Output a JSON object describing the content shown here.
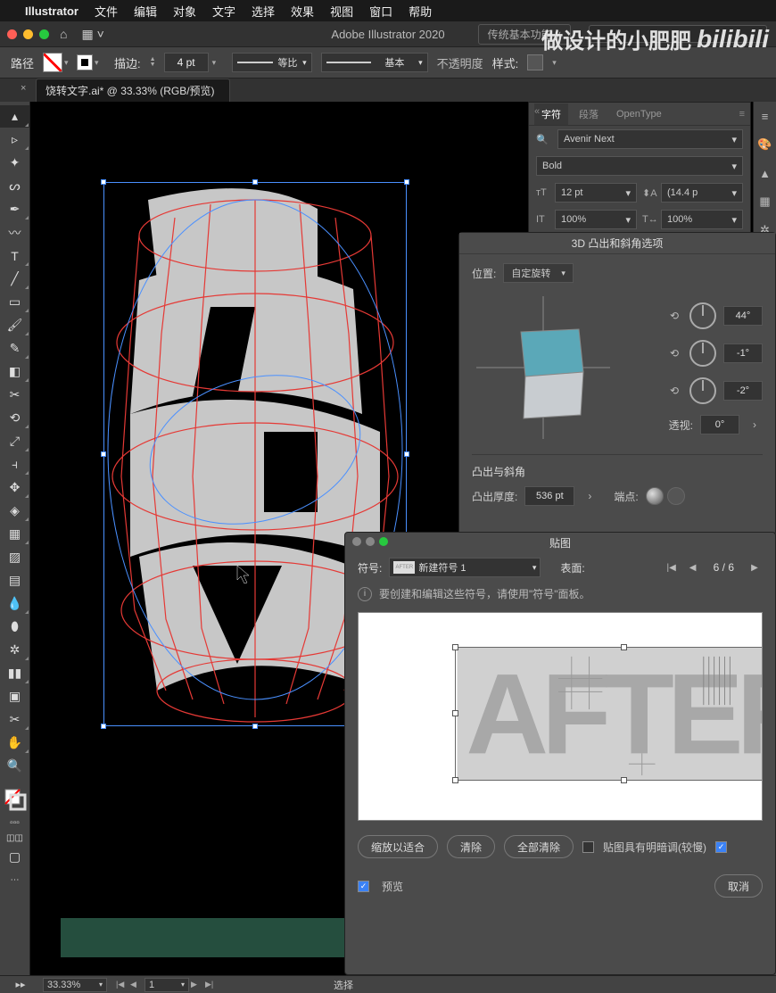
{
  "menubar": {
    "app": "Illustrator",
    "items": [
      "文件",
      "编辑",
      "对象",
      "文字",
      "选择",
      "效果",
      "视图",
      "窗口",
      "帮助"
    ]
  },
  "titlebar": {
    "appTitle": "Adobe Illustrator 2020",
    "workspace": "传统基本功能"
  },
  "watermark": {
    "cn": "做设计的小肥肥",
    "logo": "bilibili"
  },
  "controlbar": {
    "label": "路径",
    "strokeLabel": "描边:",
    "strokeWidth": "4 pt",
    "profileUniform": "等比",
    "brushBasic": "基本",
    "opacityLabel": "不透明度",
    "styleLabel": "样式:"
  },
  "doctab": {
    "name": "饶转文字.ai* @ 33.33% (RGB/预览)"
  },
  "tools": [
    "selection",
    "direct-select",
    "magic-wand",
    "lasso",
    "pen",
    "curvature",
    "type",
    "line",
    "rectangle",
    "brush",
    "pencil",
    "eraser",
    "scissors",
    "rotate",
    "scale",
    "width",
    "free-transform",
    "shape-builder",
    "perspective",
    "mesh",
    "gradient",
    "eyedropper",
    "blend",
    "symbol-sprayer",
    "column-graph",
    "artboard",
    "slice",
    "hand",
    "zoom",
    "fill-stroke",
    "swap",
    "default",
    "color",
    "gradient-mode",
    "none",
    "draw-normal",
    "screen"
  ],
  "charPanel": {
    "tabs": [
      "字符",
      "段落",
      "OpenType"
    ],
    "fontFamily": "Avenir Next",
    "fontStyle": "Bold",
    "size": "12 pt",
    "leading": "(14.4 p",
    "tracking": "100%",
    "kerning": "100%"
  },
  "dialog3d": {
    "title": "3D 凸出和斜角选项",
    "positionLabel": "位置:",
    "positionValue": "自定旋转",
    "rotX": "44°",
    "rotY": "-1°",
    "rotZ": "-2°",
    "perspectiveLabel": "透视:",
    "perspective": "0°",
    "sectionTitle": "凸出与斜角",
    "depthLabel": "凸出厚度:",
    "depth": "536 pt",
    "capLabel": "端点:"
  },
  "dialogMap": {
    "title": "贴图",
    "symbolLabel": "符号:",
    "symbolValue": "新建符号 1",
    "symbolThumb": "AFTER",
    "surfaceLabel": "表面:",
    "surfaceCount": "6 / 6",
    "info": "要创建和编辑这些符号，请使用\"符号\"面板。",
    "artText": "AFTER",
    "btnFit": "缩放以适合",
    "btnClear": "清除",
    "btnClearAll": "全部清除",
    "chkShading": "贴图具有明暗调(较慢)",
    "chkPreview": "预览",
    "btnCancel": "取消"
  },
  "statusbar": {
    "zoom": "33.33%",
    "artboard": "1",
    "mode": "选择"
  },
  "colors": {
    "accent": "#4a90ff",
    "cubeTop": "#5ba8b8",
    "cubeFront": "#c8ccd0"
  }
}
